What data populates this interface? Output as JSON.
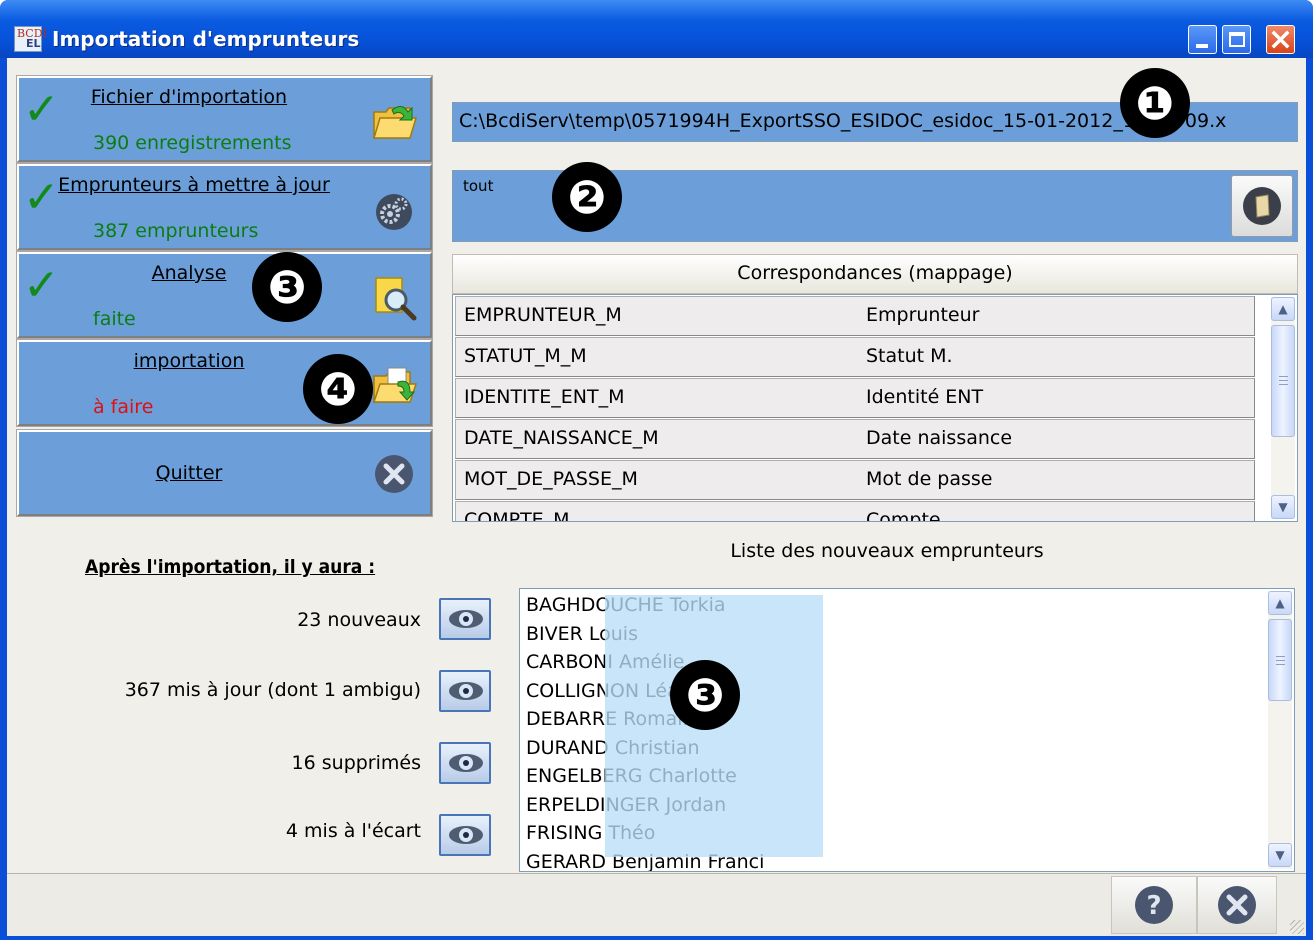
{
  "window": {
    "title": "Importation d'emprunteurs",
    "icon_text_top": "BCDI",
    "icon_text_bottom": "EL"
  },
  "steps": [
    {
      "title": "Fichier d'importation",
      "status": "390 enregistrements",
      "done": true,
      "icon": "folder-refresh-icon"
    },
    {
      "title": "Emprunteurs à mettre à jour",
      "status": "387 emprunteurs",
      "done": true,
      "icon": "gears-icon"
    },
    {
      "title": "Analyse",
      "status": "faite",
      "done": true,
      "icon": "document-magnifier-icon"
    },
    {
      "title": "importation",
      "status": "à faire",
      "done": false,
      "icon": "folder-import-icon"
    },
    {
      "title": "Quitter",
      "icon": "close-icon"
    }
  ],
  "file_path": "C:\\BcdiServ\\temp\\0571994H_ExportSSO_ESIDOC_esidoc_15-01-2012_18-31-09.x",
  "selection": {
    "value": "tout"
  },
  "mapping": {
    "header": "Correspondances  (mappage)",
    "rows": [
      [
        "EMPRUNTEUR_M",
        "Emprunteur"
      ],
      [
        "STATUT_M_M",
        "Statut M."
      ],
      [
        "IDENTITE_ENT_M",
        "Identité ENT"
      ],
      [
        "DATE_NAISSANCE_M",
        "Date naissance"
      ],
      [
        "MOT_DE_PASSE_M",
        "Mot de passe"
      ],
      [
        "COMPTE_M",
        "Compte"
      ]
    ]
  },
  "summary": {
    "title": "Après l'importation, il y aura :",
    "items": [
      {
        "label": "23 nouveaux"
      },
      {
        "label": "367 mis à jour (dont 1 ambigu)"
      },
      {
        "label": "16 supprimés"
      },
      {
        "label": "4 mis à l'écart"
      }
    ]
  },
  "new_borrowers": {
    "header": "Liste des nouveaux emprunteurs",
    "names": [
      "BAGHDOUCHE Torkia",
      "BIVER Louis",
      "CARBONI Amélie",
      "COLLIGNON Léa",
      "DEBARRE Romain",
      "DURAND Christian",
      "ENGELBERG Charlotte",
      "ERPELDINGER Jordan",
      "FRISING Théo",
      "GERARD Benjamin Franci"
    ]
  },
  "annotations": [
    "❶",
    "❷",
    "❸",
    "❹",
    "❸"
  ],
  "colors": {
    "panel_blue": "#6c9fd9",
    "check_green": "#118a1a",
    "status_green": "#0a7d12",
    "status_red": "#e01010",
    "titlebar_blue": "#0a5be0"
  }
}
